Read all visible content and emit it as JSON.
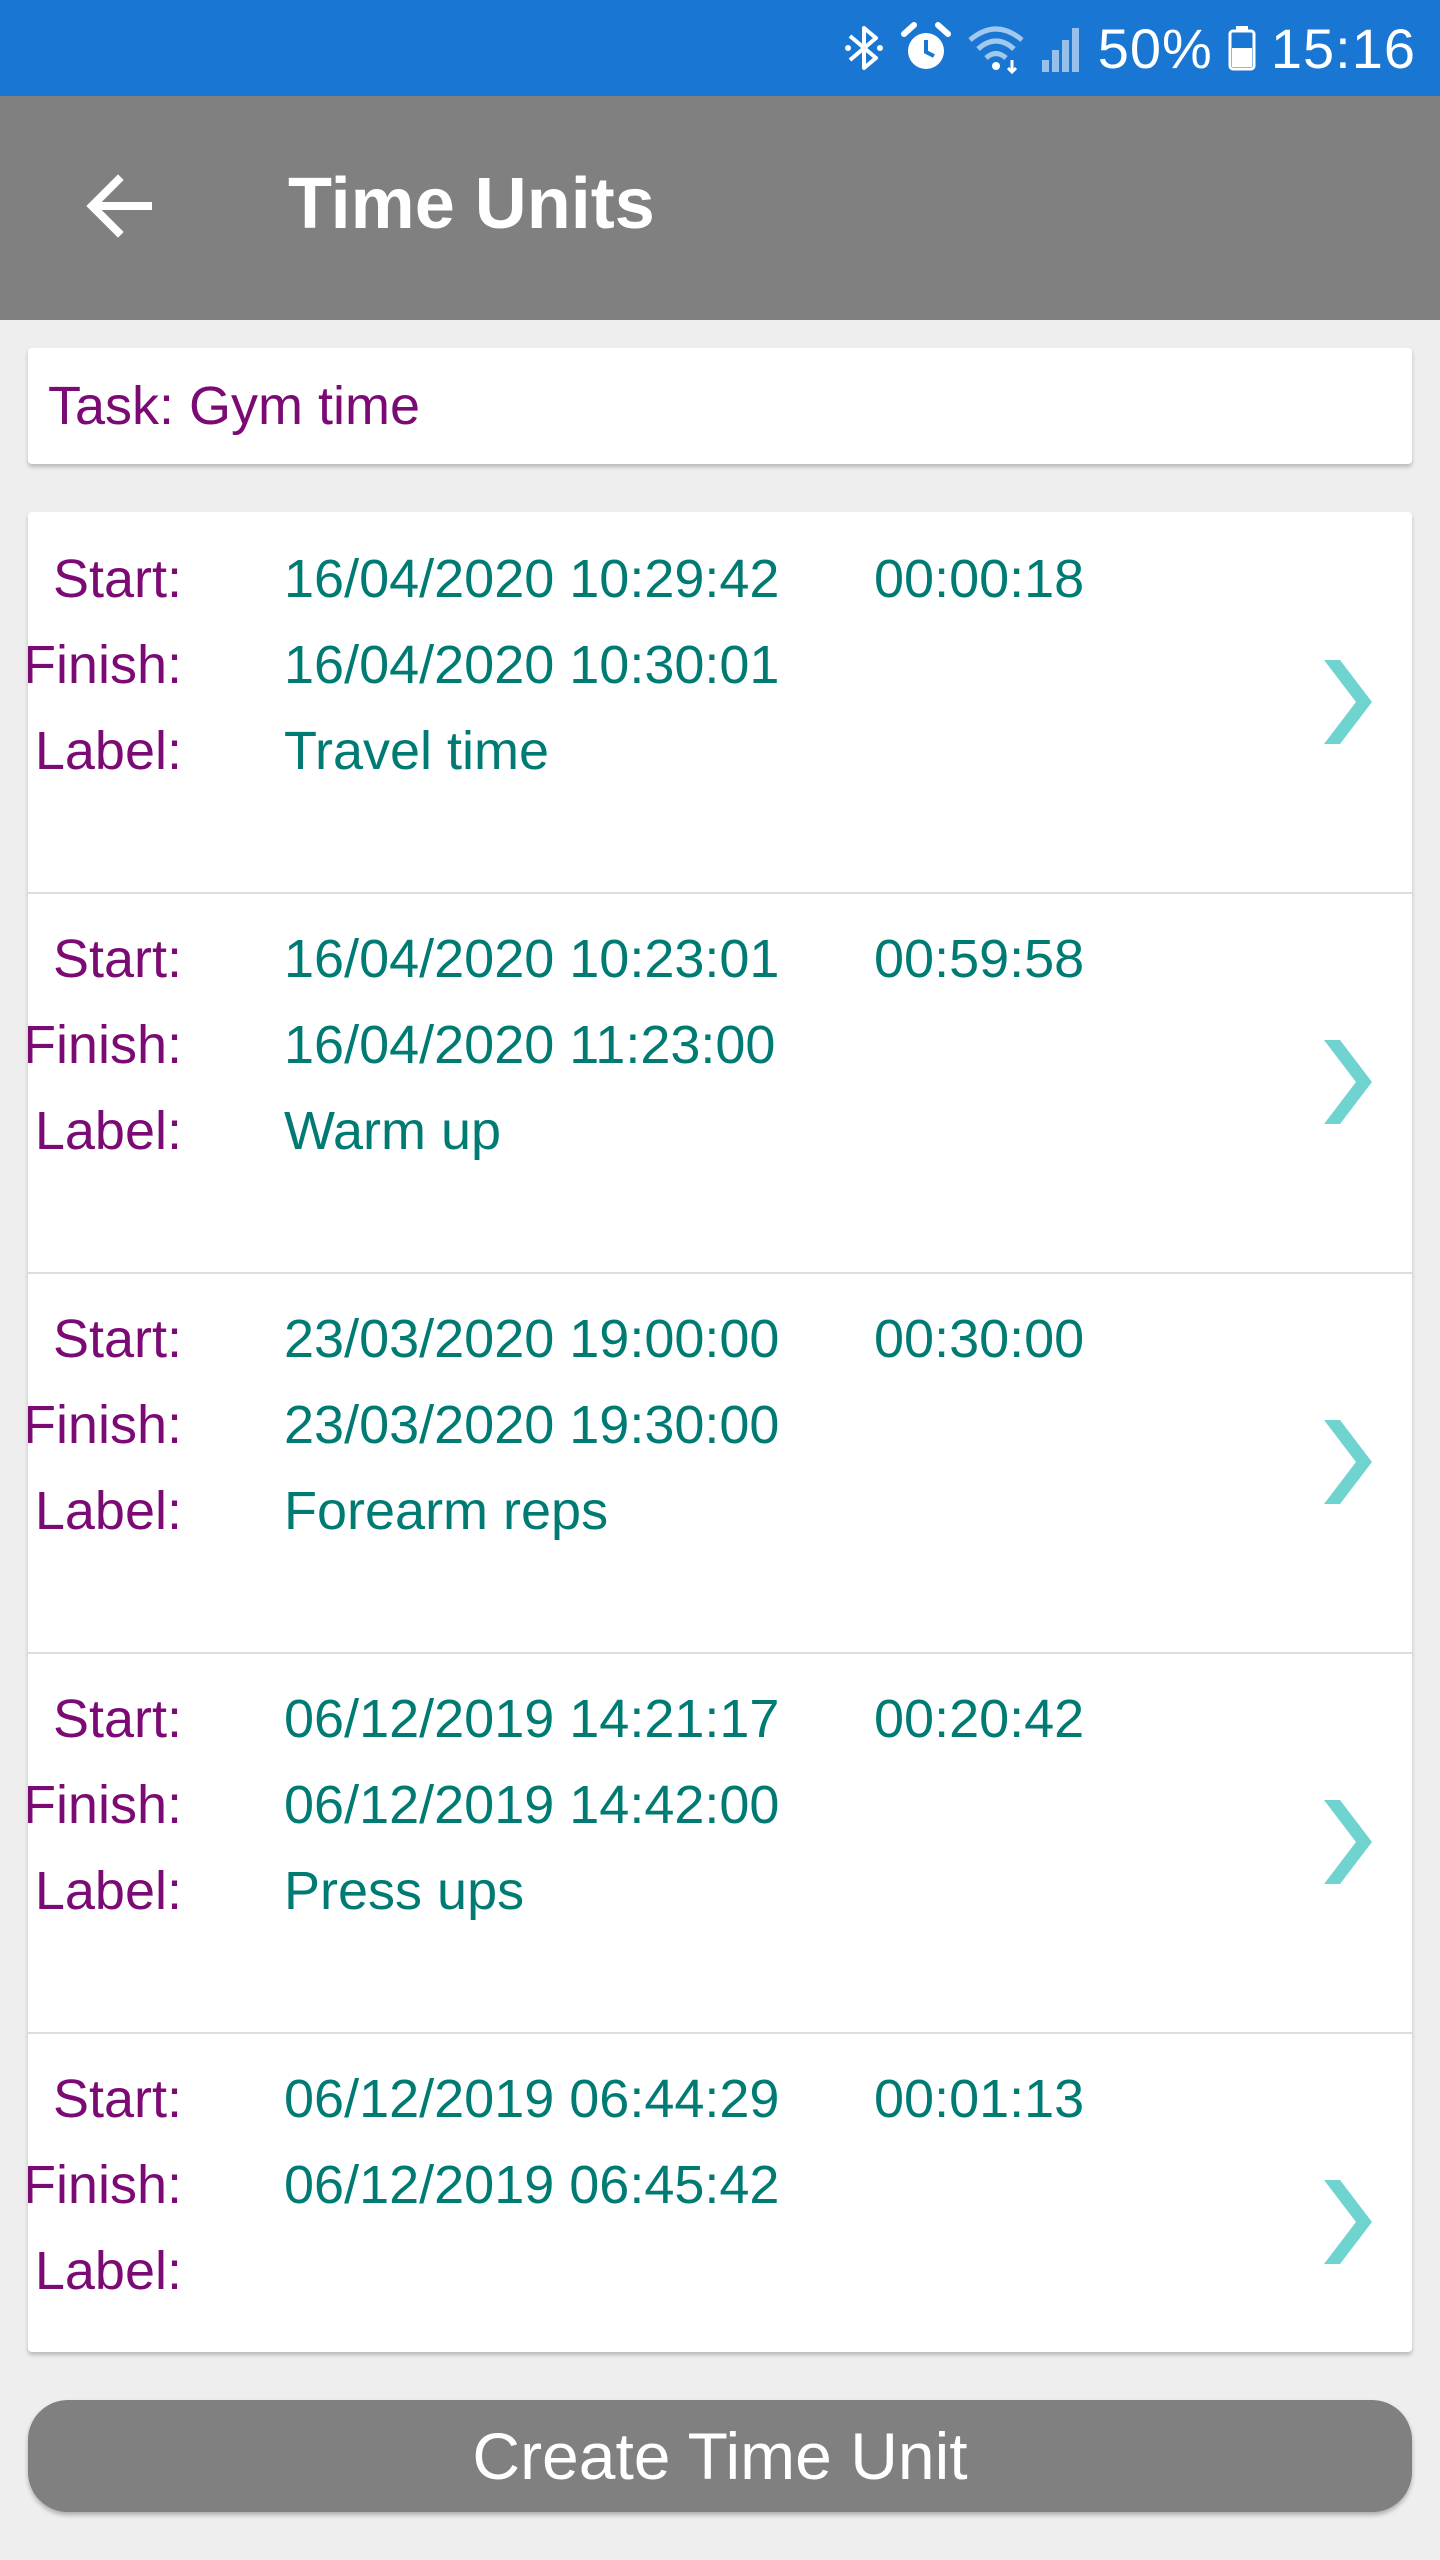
{
  "status_bar": {
    "battery": "50%",
    "time": "15:16",
    "icons": [
      "bluetooth-icon",
      "alarm-icon",
      "wifi-icon",
      "signal-icon",
      "battery-icon"
    ]
  },
  "app_bar": {
    "title": "Time Units",
    "back_icon": "arrow-left-icon"
  },
  "task": {
    "text": "Task: Gym time"
  },
  "labels": {
    "start": "Start:",
    "finish": "Finish:",
    "label": "Label:"
  },
  "time_units": [
    {
      "start": "16/04/2020 10:29:42",
      "finish": "16/04/2020 10:30:01",
      "duration": "00:00:18",
      "label": "Travel time"
    },
    {
      "start": "16/04/2020 10:23:01",
      "finish": "16/04/2020 11:23:00",
      "duration": "00:59:58",
      "label": "Warm up"
    },
    {
      "start": "23/03/2020 19:00:00",
      "finish": "23/03/2020 19:30:00",
      "duration": "00:30:00",
      "label": "Forearm reps"
    },
    {
      "start": "06/12/2019 14:21:17",
      "finish": "06/12/2019 14:42:00",
      "duration": "00:20:42",
      "label": "Press ups"
    },
    {
      "start": "06/12/2019 06:44:29",
      "finish": "06/12/2019 06:45:42",
      "duration": "00:01:13",
      "label": ""
    }
  ],
  "create_button": {
    "label": "Create Time Unit"
  },
  "colors": {
    "status_bar": "#1976d2",
    "app_bar": "#808080",
    "label_text": "#7b0a74",
    "value_text": "#007b73",
    "chevron": "#6fd3d0",
    "background": "#eeeeee"
  }
}
